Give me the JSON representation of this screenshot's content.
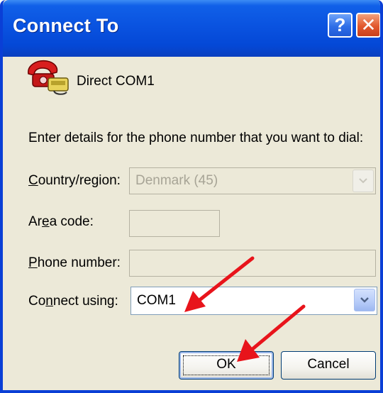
{
  "window": {
    "title": "Connect To",
    "help_label": "?",
    "close_label": "✕"
  },
  "connection": {
    "name": "Direct COM1",
    "icon": "phone-modem-icon"
  },
  "instructions": "Enter details for the phone number that you want to dial:",
  "form": {
    "country_label_u": "C",
    "country_label_rest": "ountry/region:",
    "country_value": "Denmark (45)",
    "area_label_pre": "Ar",
    "area_label_u": "e",
    "area_label_post": "a code:",
    "area_value": "",
    "phone_label_u": "P",
    "phone_label_rest": "hone number:",
    "phone_value": "",
    "connect_label_pre": "Co",
    "connect_label_u": "n",
    "connect_label_post": "nect using:",
    "connect_value": "COM1"
  },
  "buttons": {
    "ok": "OK",
    "cancel": "Cancel"
  },
  "annotations": {
    "arrow_color": "#e8141b",
    "icons": [
      "red-arrow-icon",
      "red-arrow-icon"
    ]
  },
  "colors": {
    "title_bar": "#0a53e0",
    "dialog_bg": "#ece9d8"
  }
}
